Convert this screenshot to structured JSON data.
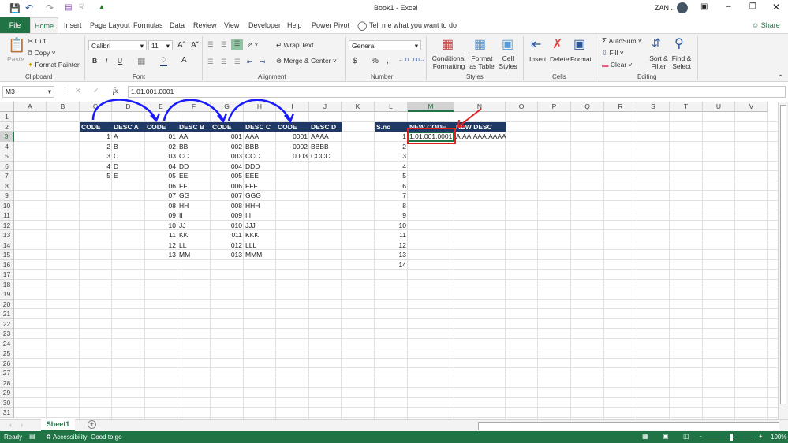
{
  "title": {
    "doc": "Book1 - Excel",
    "user": "ZAN ."
  },
  "qat": [
    "save-icon",
    "undo-icon",
    "redo-icon",
    "touch-mode-icon",
    "customize-icon"
  ],
  "tabs": {
    "file": "File",
    "items": [
      "Home",
      "Insert",
      "Page Layout",
      "Formulas",
      "Data",
      "Review",
      "View",
      "Developer",
      "Help",
      "Power Pivot"
    ],
    "tell": "Tell me what you want to do",
    "share": "Share"
  },
  "ribbon": {
    "clipboard": {
      "paste": "Paste",
      "cut": "Cut",
      "copy": "Copy",
      "painter": "Format Painter",
      "label": "Clipboard"
    },
    "font": {
      "name": "Calibri",
      "size": "11",
      "bold": "B",
      "italic": "I",
      "underline": "U",
      "label": "Font"
    },
    "alignment": {
      "wrap": "Wrap Text",
      "merge": "Merge & Center",
      "label": "Alignment"
    },
    "number": {
      "format": "General",
      "currency": "$",
      "percent": "%",
      "comma": ",",
      "label": "Number"
    },
    "styles": {
      "conditional": "Conditional Formatting",
      "table": "Format as Table",
      "cell": "Cell Styles",
      "label": "Styles"
    },
    "cells": {
      "insert": "Insert",
      "delete": "Delete",
      "format": "Format",
      "label": "Cells"
    },
    "editing": {
      "autosum": "AutoSum",
      "fill": "Fill",
      "clear": "Clear",
      "sort": "Sort & Filter",
      "find": "Find & Select",
      "label": "Editing"
    }
  },
  "formula": {
    "namebox": "M3",
    "fx": "fx",
    "value": "1.01.001.0001"
  },
  "columns": [
    "A",
    "B",
    "C",
    "D",
    "E",
    "F",
    "G",
    "H",
    "I",
    "J",
    "K",
    "L",
    "M",
    "N",
    "O",
    "P",
    "Q",
    "R",
    "S",
    "T",
    "U",
    "V"
  ],
  "rows": 31,
  "selected": "M3",
  "cells": [
    {
      "c": "C",
      "r": 2,
      "v": "CODE",
      "h": 1
    },
    {
      "c": "D",
      "r": 2,
      "v": "DESC A",
      "h": 1
    },
    {
      "c": "E",
      "r": 2,
      "v": "CODE",
      "h": 1
    },
    {
      "c": "F",
      "r": 2,
      "v": "DESC B",
      "h": 1
    },
    {
      "c": "G",
      "r": 2,
      "v": "CODE",
      "h": 1
    },
    {
      "c": "H",
      "r": 2,
      "v": "DESC C",
      "h": 1
    },
    {
      "c": "I",
      "r": 2,
      "v": "CODE",
      "h": 1
    },
    {
      "c": "J",
      "r": 2,
      "v": "DESC D",
      "h": 1
    },
    {
      "c": "L",
      "r": 2,
      "v": "S.no",
      "h": 1
    },
    {
      "c": "M",
      "r": 2,
      "v": "NEW CODE",
      "h": 1
    },
    {
      "c": "N",
      "r": 2,
      "v": "NEW DESC",
      "h": 1
    },
    {
      "c": "C",
      "r": 3,
      "v": "1",
      "a": "r"
    },
    {
      "c": "D",
      "r": 3,
      "v": "A"
    },
    {
      "c": "C",
      "r": 4,
      "v": "2",
      "a": "r"
    },
    {
      "c": "D",
      "r": 4,
      "v": "B"
    },
    {
      "c": "C",
      "r": 5,
      "v": "3",
      "a": "r"
    },
    {
      "c": "D",
      "r": 5,
      "v": "C"
    },
    {
      "c": "C",
      "r": 6,
      "v": "4",
      "a": "r"
    },
    {
      "c": "D",
      "r": 6,
      "v": "D"
    },
    {
      "c": "C",
      "r": 7,
      "v": "5",
      "a": "r"
    },
    {
      "c": "D",
      "r": 7,
      "v": "E"
    },
    {
      "c": "E",
      "r": 3,
      "v": "01",
      "a": "r"
    },
    {
      "c": "F",
      "r": 3,
      "v": "AA"
    },
    {
      "c": "E",
      "r": 4,
      "v": "02",
      "a": "r"
    },
    {
      "c": "F",
      "r": 4,
      "v": "BB"
    },
    {
      "c": "E",
      "r": 5,
      "v": "03",
      "a": "r"
    },
    {
      "c": "F",
      "r": 5,
      "v": "CC"
    },
    {
      "c": "E",
      "r": 6,
      "v": "04",
      "a": "r"
    },
    {
      "c": "F",
      "r": 6,
      "v": "DD"
    },
    {
      "c": "E",
      "r": 7,
      "v": "05",
      "a": "r"
    },
    {
      "c": "F",
      "r": 7,
      "v": "EE"
    },
    {
      "c": "E",
      "r": 8,
      "v": "06",
      "a": "r"
    },
    {
      "c": "F",
      "r": 8,
      "v": "FF"
    },
    {
      "c": "E",
      "r": 9,
      "v": "07",
      "a": "r"
    },
    {
      "c": "F",
      "r": 9,
      "v": "GG"
    },
    {
      "c": "E",
      "r": 10,
      "v": "08",
      "a": "r"
    },
    {
      "c": "F",
      "r": 10,
      "v": "HH"
    },
    {
      "c": "E",
      "r": 11,
      "v": "09",
      "a": "r"
    },
    {
      "c": "F",
      "r": 11,
      "v": "II"
    },
    {
      "c": "E",
      "r": 12,
      "v": "10",
      "a": "r"
    },
    {
      "c": "F",
      "r": 12,
      "v": "JJ"
    },
    {
      "c": "E",
      "r": 13,
      "v": "11",
      "a": "r"
    },
    {
      "c": "F",
      "r": 13,
      "v": "KK"
    },
    {
      "c": "E",
      "r": 14,
      "v": "12",
      "a": "r"
    },
    {
      "c": "F",
      "r": 14,
      "v": "LL"
    },
    {
      "c": "E",
      "r": 15,
      "v": "13",
      "a": "r"
    },
    {
      "c": "F",
      "r": 15,
      "v": "MM"
    },
    {
      "c": "G",
      "r": 3,
      "v": "001",
      "a": "r"
    },
    {
      "c": "H",
      "r": 3,
      "v": "AAA"
    },
    {
      "c": "G",
      "r": 4,
      "v": "002",
      "a": "r"
    },
    {
      "c": "H",
      "r": 4,
      "v": "BBB"
    },
    {
      "c": "G",
      "r": 5,
      "v": "003",
      "a": "r"
    },
    {
      "c": "H",
      "r": 5,
      "v": "CCC"
    },
    {
      "c": "G",
      "r": 6,
      "v": "004",
      "a": "r"
    },
    {
      "c": "H",
      "r": 6,
      "v": "DDD"
    },
    {
      "c": "G",
      "r": 7,
      "v": "005",
      "a": "r"
    },
    {
      "c": "H",
      "r": 7,
      "v": "EEE"
    },
    {
      "c": "G",
      "r": 8,
      "v": "006",
      "a": "r"
    },
    {
      "c": "H",
      "r": 8,
      "v": "FFF"
    },
    {
      "c": "G",
      "r": 9,
      "v": "007",
      "a": "r"
    },
    {
      "c": "H",
      "r": 9,
      "v": "GGG"
    },
    {
      "c": "G",
      "r": 10,
      "v": "008",
      "a": "r"
    },
    {
      "c": "H",
      "r": 10,
      "v": "HHH"
    },
    {
      "c": "G",
      "r": 11,
      "v": "009",
      "a": "r"
    },
    {
      "c": "H",
      "r": 11,
      "v": "III"
    },
    {
      "c": "G",
      "r": 12,
      "v": "010",
      "a": "r"
    },
    {
      "c": "H",
      "r": 12,
      "v": "JJJ"
    },
    {
      "c": "G",
      "r": 13,
      "v": "011",
      "a": "r"
    },
    {
      "c": "H",
      "r": 13,
      "v": "KKK"
    },
    {
      "c": "G",
      "r": 14,
      "v": "012",
      "a": "r"
    },
    {
      "c": "H",
      "r": 14,
      "v": "LLL"
    },
    {
      "c": "G",
      "r": 15,
      "v": "013",
      "a": "r"
    },
    {
      "c": "H",
      "r": 15,
      "v": "MMM"
    },
    {
      "c": "I",
      "r": 3,
      "v": "0001",
      "a": "r"
    },
    {
      "c": "J",
      "r": 3,
      "v": "AAAA"
    },
    {
      "c": "I",
      "r": 4,
      "v": "0002",
      "a": "r"
    },
    {
      "c": "J",
      "r": 4,
      "v": "BBBB"
    },
    {
      "c": "I",
      "r": 5,
      "v": "0003",
      "a": "r"
    },
    {
      "c": "J",
      "r": 5,
      "v": "CCCC"
    },
    {
      "c": "L",
      "r": 3,
      "v": "1",
      "a": "r"
    },
    {
      "c": "L",
      "r": 4,
      "v": "2",
      "a": "r"
    },
    {
      "c": "L",
      "r": 5,
      "v": "3",
      "a": "r"
    },
    {
      "c": "L",
      "r": 6,
      "v": "4",
      "a": "r"
    },
    {
      "c": "L",
      "r": 7,
      "v": "5",
      "a": "r"
    },
    {
      "c": "L",
      "r": 8,
      "v": "6",
      "a": "r"
    },
    {
      "c": "L",
      "r": 9,
      "v": "7",
      "a": "r"
    },
    {
      "c": "L",
      "r": 10,
      "v": "8",
      "a": "r"
    },
    {
      "c": "L",
      "r": 11,
      "v": "9",
      "a": "r"
    },
    {
      "c": "L",
      "r": 12,
      "v": "10",
      "a": "r"
    },
    {
      "c": "L",
      "r": 13,
      "v": "11",
      "a": "r"
    },
    {
      "c": "L",
      "r": 14,
      "v": "12",
      "a": "r"
    },
    {
      "c": "L",
      "r": 15,
      "v": "13",
      "a": "r"
    },
    {
      "c": "L",
      "r": 16,
      "v": "14",
      "a": "r"
    },
    {
      "c": "M",
      "r": 3,
      "v": "1.01.001.0001"
    },
    {
      "c": "N",
      "r": 3,
      "v": "A.AA.AAA.AAAA"
    }
  ],
  "sheets": {
    "active": "Sheet1",
    "add": "+"
  },
  "status": {
    "ready": "Ready",
    "accessibility": "Accessibility: Good to go",
    "zoom": "100%",
    "zoom_minus": "-",
    "zoom_plus": "+"
  },
  "colors": {
    "excel_green": "#217346",
    "header_navy": "#1f3864",
    "annotation_blue": "#1a1aff",
    "annotation_red": "#e02020"
  }
}
